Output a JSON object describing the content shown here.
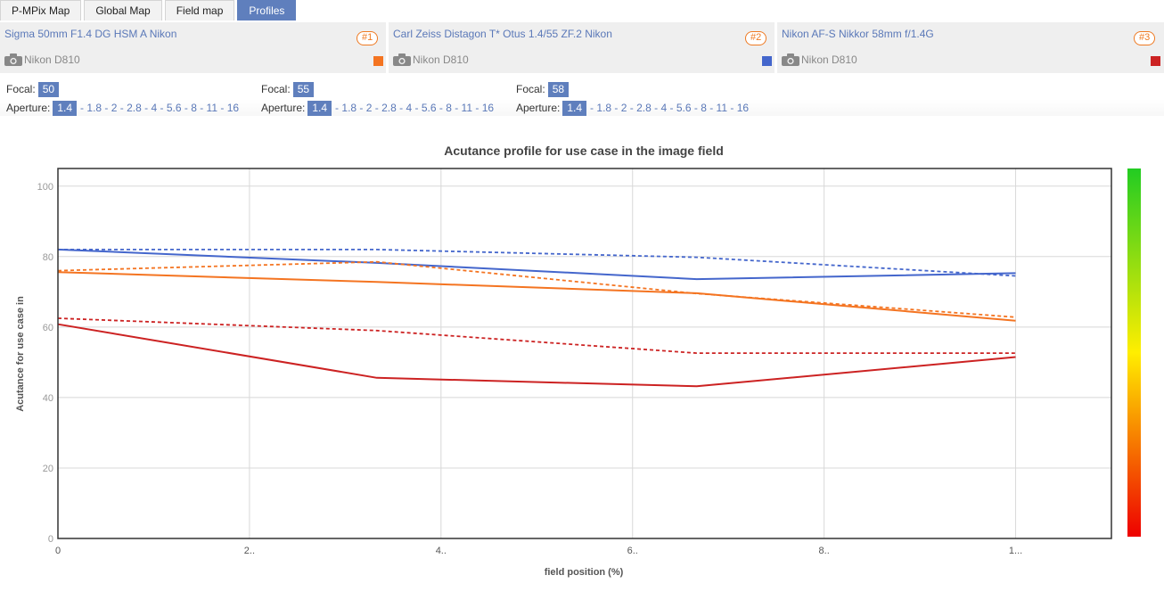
{
  "tabs": [
    {
      "label": "P-MPix Map",
      "active": false
    },
    {
      "label": "Global Map",
      "active": false
    },
    {
      "label": "Field map",
      "active": false
    },
    {
      "label": "Profiles",
      "active": true
    }
  ],
  "lenses": [
    {
      "name": "Sigma 50mm F1.4 DG HSM A Nikon",
      "number": "#1",
      "camera": "Nikon D810",
      "color": "#f47421",
      "focal_label": "Focal:",
      "focal": "50",
      "aperture_label": "Aperture:",
      "aperture_selected": "1.4",
      "apertures": [
        "1.8",
        "2",
        "2.8",
        "4",
        "5.6",
        "8",
        "11",
        "16"
      ]
    },
    {
      "name": "Carl Zeiss Distagon T* Otus 1.4/55 ZF.2 Nikon",
      "number": "#2",
      "camera": "Nikon D810",
      "color": "#4466cc",
      "focal_label": "Focal:",
      "focal": "55",
      "aperture_label": "Aperture:",
      "aperture_selected": "1.4",
      "apertures": [
        "1.8",
        "2",
        "2.8",
        "4",
        "5.6",
        "8",
        "11",
        "16"
      ]
    },
    {
      "name": "Nikon AF-S Nikkor 58mm f/1.4G",
      "number": "#3",
      "camera": "Nikon D810",
      "color": "#cc2222",
      "focal_label": "Focal:",
      "focal": "58",
      "aperture_label": "Aperture:",
      "aperture_selected": "1.4",
      "apertures": [
        "1.8",
        "2",
        "2.8",
        "4",
        "5.6",
        "8",
        "11",
        "16"
      ]
    }
  ],
  "chart_data": {
    "type": "line",
    "title": "Acutance profile for use case in the image field",
    "xlabel": "field position (%)",
    "ylabel": "Acutance for use case in",
    "xlim": [
      0,
      110
    ],
    "ylim": [
      0,
      105
    ],
    "x_ticks": [
      0,
      20,
      40,
      60,
      80,
      100
    ],
    "x_tick_labels": [
      "0",
      "2..",
      "4..",
      "6..",
      "8..",
      "1..."
    ],
    "y_ticks": [
      0,
      20,
      40,
      60,
      80,
      100
    ],
    "y_tick_labels": [
      "0",
      "20",
      "40",
      "60",
      "80",
      "100"
    ],
    "grid": true,
    "colorbar": {
      "top_color": "#22cc22",
      "bottom_color": "#ee0000"
    },
    "series": [
      {
        "color": "#4466cc",
        "style": "solid",
        "x": [
          0,
          33.3,
          66.7,
          100
        ],
        "y": [
          82,
          78.2,
          73.6,
          75.3
        ]
      },
      {
        "color": "#4466cc",
        "style": "dashed",
        "x": [
          0,
          33.3,
          66.7,
          100
        ],
        "y": [
          82,
          82,
          79.8,
          74.5
        ]
      },
      {
        "color": "#f47421",
        "style": "solid",
        "x": [
          0,
          33.3,
          66.7,
          100
        ],
        "y": [
          75.6,
          72.8,
          69.6,
          61.8
        ]
      },
      {
        "color": "#f47421",
        "style": "dashed",
        "x": [
          0,
          33.3,
          66.7,
          100
        ],
        "y": [
          76,
          78.5,
          69.5,
          62.8
        ]
      },
      {
        "color": "#cc2222",
        "style": "solid",
        "x": [
          0,
          33.3,
          66.7,
          100
        ],
        "y": [
          60.8,
          45.6,
          43.2,
          51.5
        ]
      },
      {
        "color": "#cc2222",
        "style": "dashed",
        "x": [
          0,
          33.3,
          66.7,
          100
        ],
        "y": [
          62.5,
          59,
          52.6,
          52.6
        ]
      }
    ]
  }
}
